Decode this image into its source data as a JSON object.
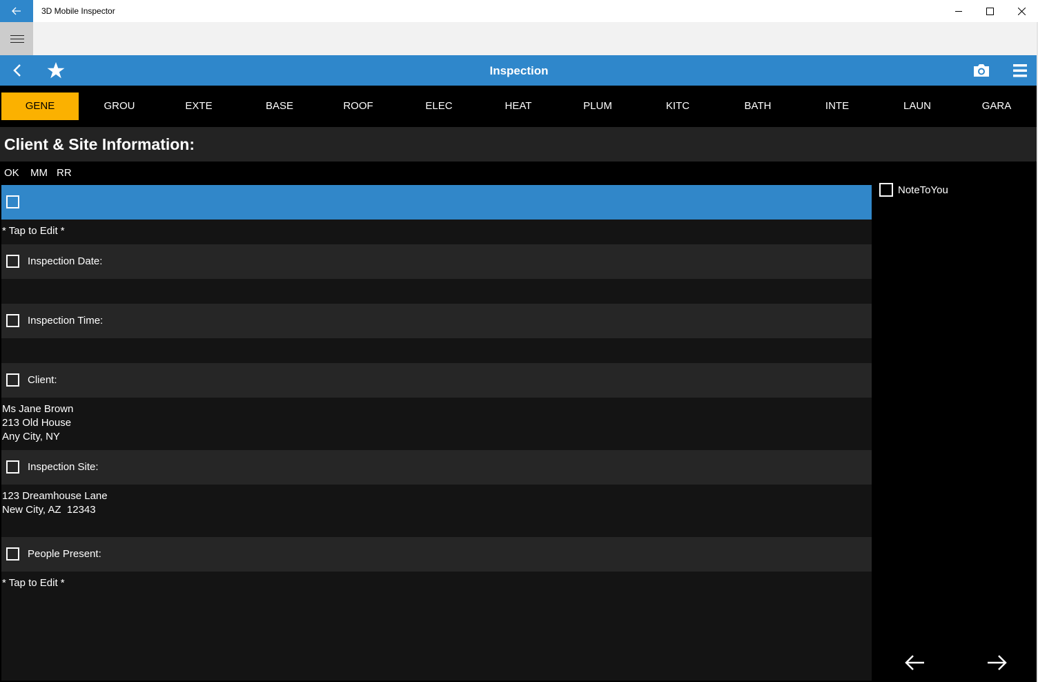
{
  "window": {
    "title": "3D Mobile Inspector",
    "back_icon": "arrow-left-icon",
    "controls": [
      "minimize-icon",
      "maximize-icon",
      "close-icon"
    ]
  },
  "appbar": {
    "menu_icon": "hamburger-icon"
  },
  "header": {
    "title": "Inspection",
    "left_icons": [
      "chevron-left-icon",
      "star-icon"
    ],
    "right_icons": [
      "camera-icon",
      "menu-icon"
    ],
    "color": "#2f87cb"
  },
  "tabs": [
    {
      "label": "GENE",
      "active": true
    },
    {
      "label": "GROU"
    },
    {
      "label": "EXTE"
    },
    {
      "label": "BASE"
    },
    {
      "label": "ROOF"
    },
    {
      "label": "ELEC"
    },
    {
      "label": "HEAT"
    },
    {
      "label": "PLUM"
    },
    {
      "label": "KITC"
    },
    {
      "label": "BATH"
    },
    {
      "label": "INTE"
    },
    {
      "label": "LAUN"
    },
    {
      "label": "GARA"
    }
  ],
  "active_tab_color": "#fbb100",
  "section": {
    "title": "Client & Site Information:",
    "legend": [
      "OK",
      "MM",
      "RR"
    ]
  },
  "rows": [
    {
      "label": "",
      "checked": false,
      "selected": true,
      "body": "* Tap to Edit *"
    },
    {
      "label": "Inspection Date:",
      "checked": false,
      "body": ""
    },
    {
      "label": "Inspection Time:",
      "checked": false,
      "body": ""
    },
    {
      "label": "Client:",
      "checked": false,
      "body": "Ms Jane Brown\n213 Old House\nAny City, NY"
    },
    {
      "label": "Inspection Site:",
      "checked": false,
      "body": "123 Dreamhouse Lane\nNew City, AZ  12343"
    },
    {
      "label": "People Present:",
      "checked": false,
      "body": "* Tap to Edit *"
    }
  ],
  "side": {
    "note_label": "NoteToYou",
    "note_checked": false
  },
  "footer_nav": [
    "arrow-left-icon",
    "arrow-right-icon"
  ]
}
